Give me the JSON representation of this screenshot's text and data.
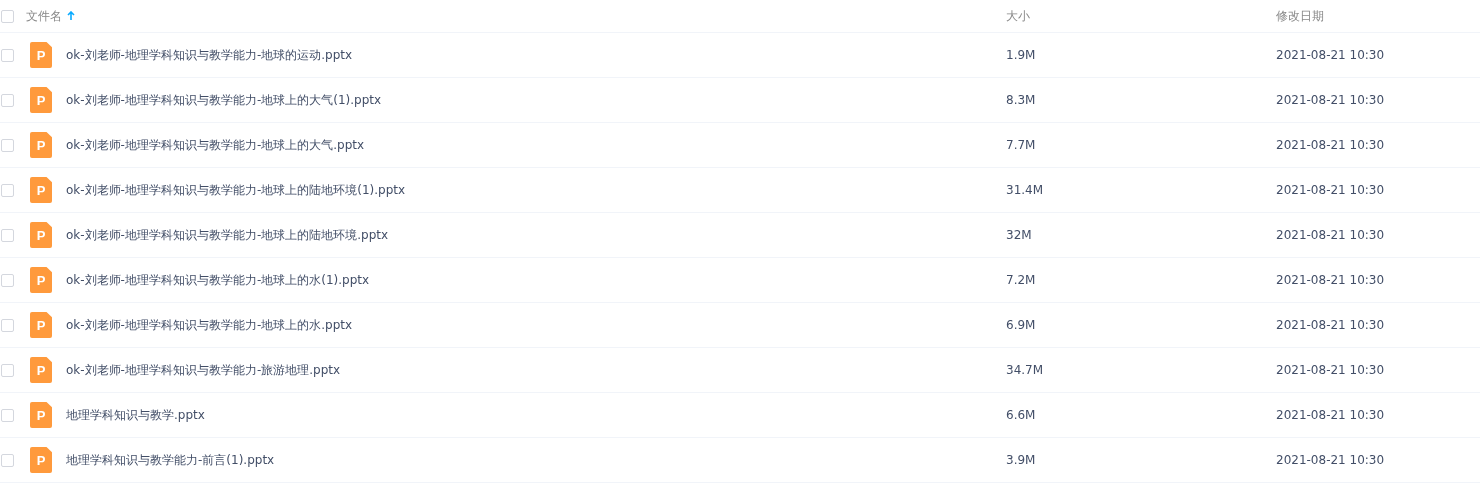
{
  "header": {
    "checked": false,
    "columns": [
      {
        "label": "文件名",
        "sorted_ascending": true
      },
      {
        "label": "大小",
        "sorted_ascending": false
      },
      {
        "label": "修改日期",
        "sorted_ascending": false
      }
    ]
  },
  "files": [
    {
      "checked": false,
      "icon_letter": "P",
      "name": "ok-刘老师-地理学科知识与教学能力-地球的运动.pptx",
      "size": "1.9M",
      "modified": "2021-08-21 10:30"
    },
    {
      "checked": false,
      "icon_letter": "P",
      "name": "ok-刘老师-地理学科知识与教学能力-地球上的大气(1).pptx",
      "size": "8.3M",
      "modified": "2021-08-21 10:30"
    },
    {
      "checked": false,
      "icon_letter": "P",
      "name": "ok-刘老师-地理学科知识与教学能力-地球上的大气.pptx",
      "size": "7.7M",
      "modified": "2021-08-21 10:30"
    },
    {
      "checked": false,
      "icon_letter": "P",
      "name": "ok-刘老师-地理学科知识与教学能力-地球上的陆地环境(1).pptx",
      "size": "31.4M",
      "modified": "2021-08-21 10:30"
    },
    {
      "checked": false,
      "icon_letter": "P",
      "name": "ok-刘老师-地理学科知识与教学能力-地球上的陆地环境.pptx",
      "size": "32M",
      "modified": "2021-08-21 10:30"
    },
    {
      "checked": false,
      "icon_letter": "P",
      "name": "ok-刘老师-地理学科知识与教学能力-地球上的水(1).pptx",
      "size": "7.2M",
      "modified": "2021-08-21 10:30"
    },
    {
      "checked": false,
      "icon_letter": "P",
      "name": "ok-刘老师-地理学科知识与教学能力-地球上的水.pptx",
      "size": "6.9M",
      "modified": "2021-08-21 10:30"
    },
    {
      "checked": false,
      "icon_letter": "P",
      "name": "ok-刘老师-地理学科知识与教学能力-旅游地理.pptx",
      "size": "34.7M",
      "modified": "2021-08-21 10:30"
    },
    {
      "checked": false,
      "icon_letter": "P",
      "name": "地理学科知识与教学.pptx",
      "size": "6.6M",
      "modified": "2021-08-21 10:30"
    },
    {
      "checked": false,
      "icon_letter": "P",
      "name": "地理学科知识与教学能力-前言(1).pptx",
      "size": "3.9M",
      "modified": "2021-08-21 10:30"
    }
  ]
}
